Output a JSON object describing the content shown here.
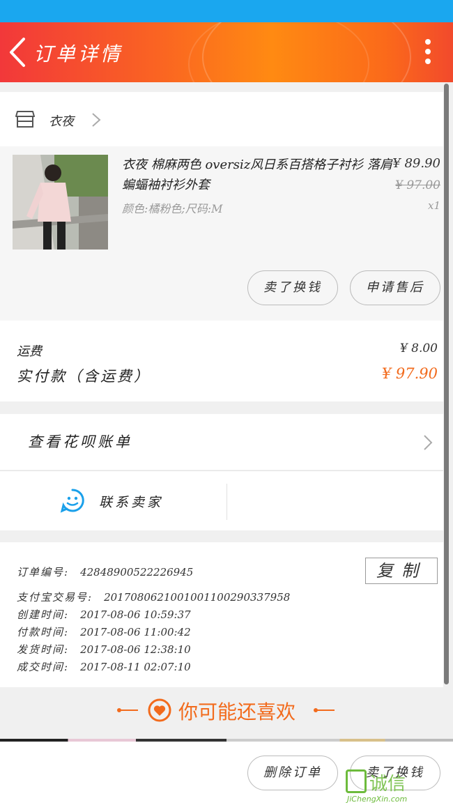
{
  "header": {
    "title": "订单详情"
  },
  "shop": {
    "name": "衣夜"
  },
  "product": {
    "title": "衣夜 棉麻两色 oversiz风日系百搭格子衬衫 落肩蝙蝠袖衬衫外套",
    "spec": "颜色:橘粉色;尺码:M",
    "price": "¥ 89.90",
    "original_price": "¥ 97.00",
    "quantity": "x1",
    "buttons": {
      "sell_label": "卖了换钱",
      "after_sale_label": "申请售后"
    }
  },
  "fees": {
    "shipping_label": "运费",
    "shipping_value": "¥ 8.00",
    "paid_label": "实付款（含运费）",
    "paid_value": "¥ 97.90"
  },
  "huabei": {
    "label": "查看花呗账单"
  },
  "contact": {
    "label": "联系卖家"
  },
  "order_info": {
    "copy_label": "复制",
    "rows": [
      {
        "label": "订单编号:",
        "value": "42848900522226945"
      },
      {
        "label": "支付宝交易号:",
        "value": "2017080621001001100290337958"
      },
      {
        "label": "创建时间:",
        "value": "2017-08-06 10:59:37"
      },
      {
        "label": "付款时间:",
        "value": "2017-08-06 11:00:42"
      },
      {
        "label": "发货时间:",
        "value": "2017-08-06 12:38:10"
      },
      {
        "label": "成交时间:",
        "value": "2017-08-11 02:07:10"
      }
    ]
  },
  "recommend": {
    "title": "你可能还喜欢"
  },
  "footer": {
    "delete_label": "删除订单",
    "sell_label": "卖了换钱"
  },
  "watermark": {
    "text": "诚信",
    "sub": "JiChengXin.com"
  },
  "colors": {
    "accent": "#f26b1d",
    "status_bar": "#1aa7ef",
    "watermark": "#6dbb3c"
  }
}
